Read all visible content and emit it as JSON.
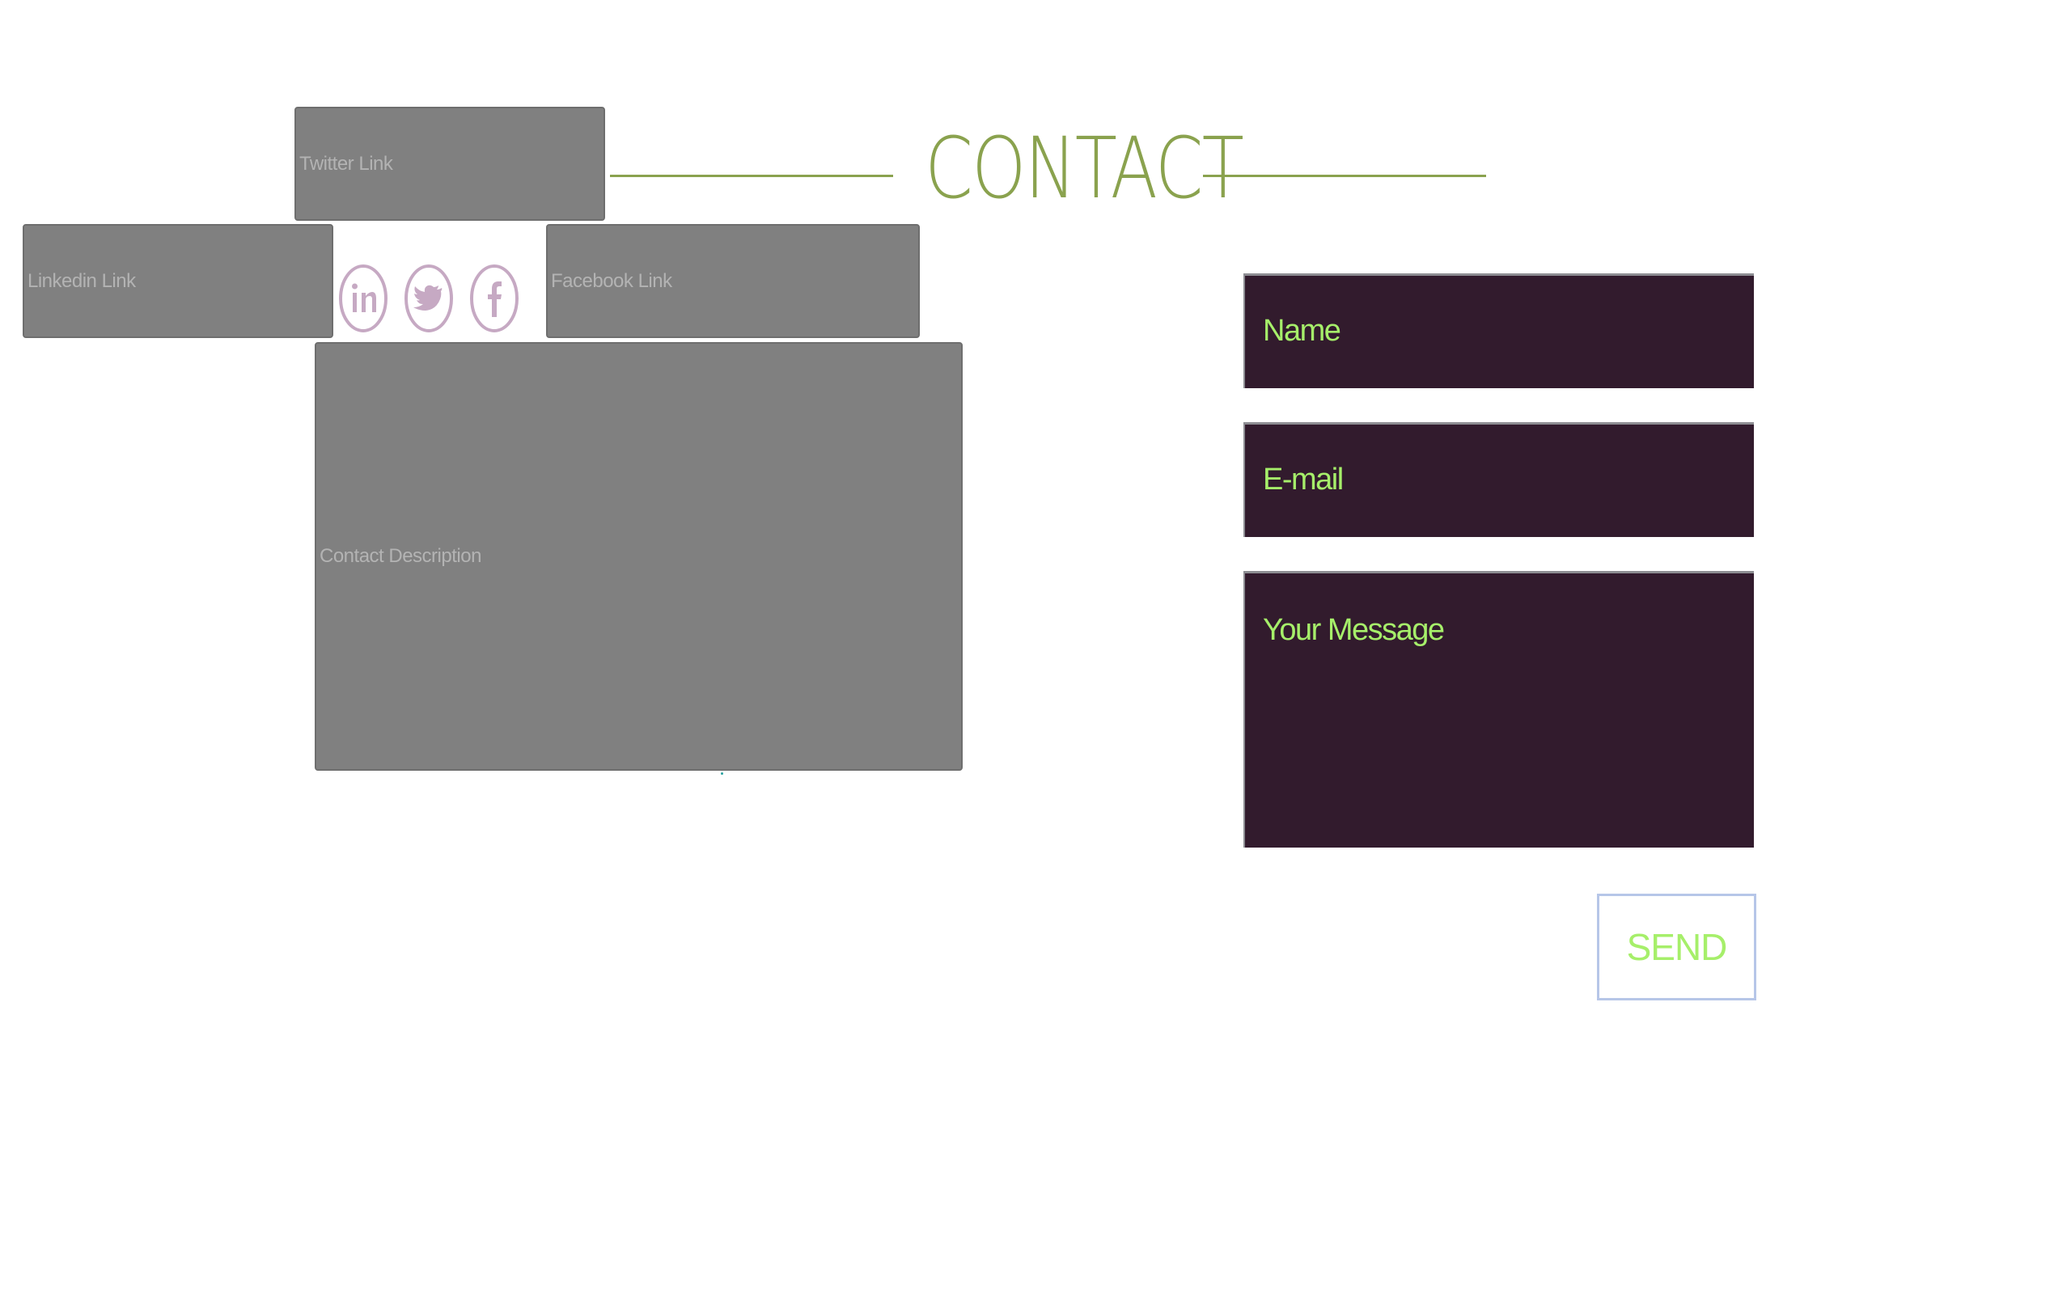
{
  "heading": {
    "title": "CONTACT"
  },
  "placeholders": {
    "twitter": "Twitter Link",
    "linkedin": "Linkedin Link",
    "facebook": "Facebook Link",
    "description": "Contact Description"
  },
  "social_icons": [
    {
      "icon": "linkedin-icon"
    },
    {
      "icon": "twitter-icon"
    },
    {
      "icon": "facebook-icon"
    }
  ],
  "form": {
    "name_label": "Name",
    "email_label": "E-mail",
    "message_label": "Your Message",
    "send_label": "SEND"
  },
  "colors": {
    "accent": "#8aa24e",
    "field_bg": "#321b2d",
    "field_text": "#a6ef6a",
    "placeholder_bg": "#808080",
    "icon_stroke": "#c6a9c3",
    "button_border": "#b6c6e8"
  }
}
